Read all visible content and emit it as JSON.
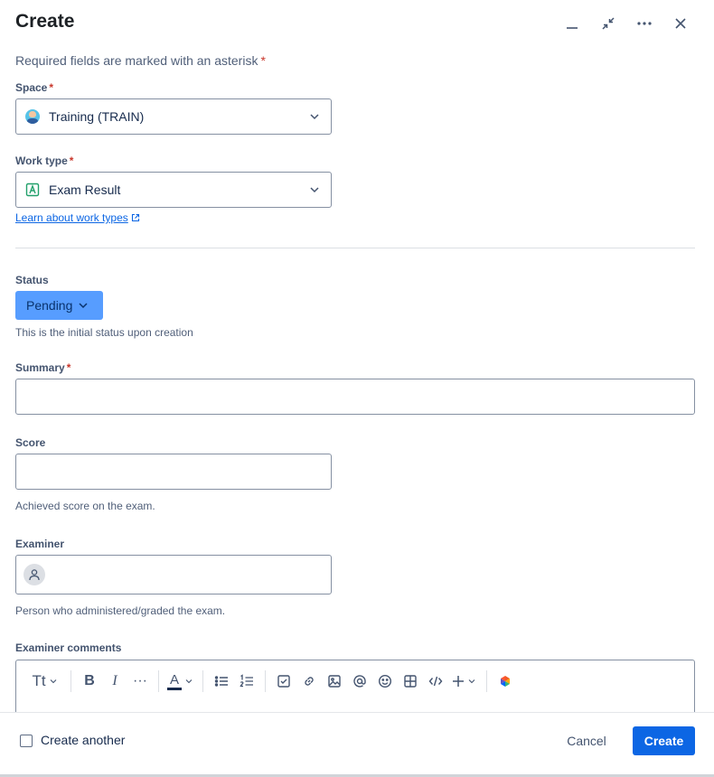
{
  "dialog": {
    "title": "Create",
    "required_note": "Required fields are marked with an asterisk",
    "required_marker": "*"
  },
  "header_icons": [
    "minimize-icon",
    "collapse-icon",
    "more-icon",
    "close-icon"
  ],
  "space": {
    "label": "Space",
    "value": "Training (TRAIN)"
  },
  "work_type": {
    "label": "Work type",
    "value": "Exam Result",
    "learn_link": "Learn about work types"
  },
  "status": {
    "label": "Status",
    "value": "Pending",
    "help": "This is the initial status upon creation"
  },
  "summary": {
    "label": "Summary",
    "value": ""
  },
  "score": {
    "label": "Score",
    "value": "",
    "help": "Achieved score on the exam."
  },
  "examiner": {
    "label": "Examiner",
    "help": "Person who administered/graded the exam."
  },
  "examiner_comments": {
    "label": "Examiner comments",
    "toolbar": {
      "text_style": "Tt",
      "bold": "B",
      "italic": "I",
      "more": "···",
      "text_color": "A"
    }
  },
  "footer": {
    "create_another": "Create another",
    "cancel": "Cancel",
    "create": "Create"
  },
  "colors": {
    "primary": "#0c66e4",
    "status_bg": "#579dff",
    "required": "#c9372c"
  }
}
